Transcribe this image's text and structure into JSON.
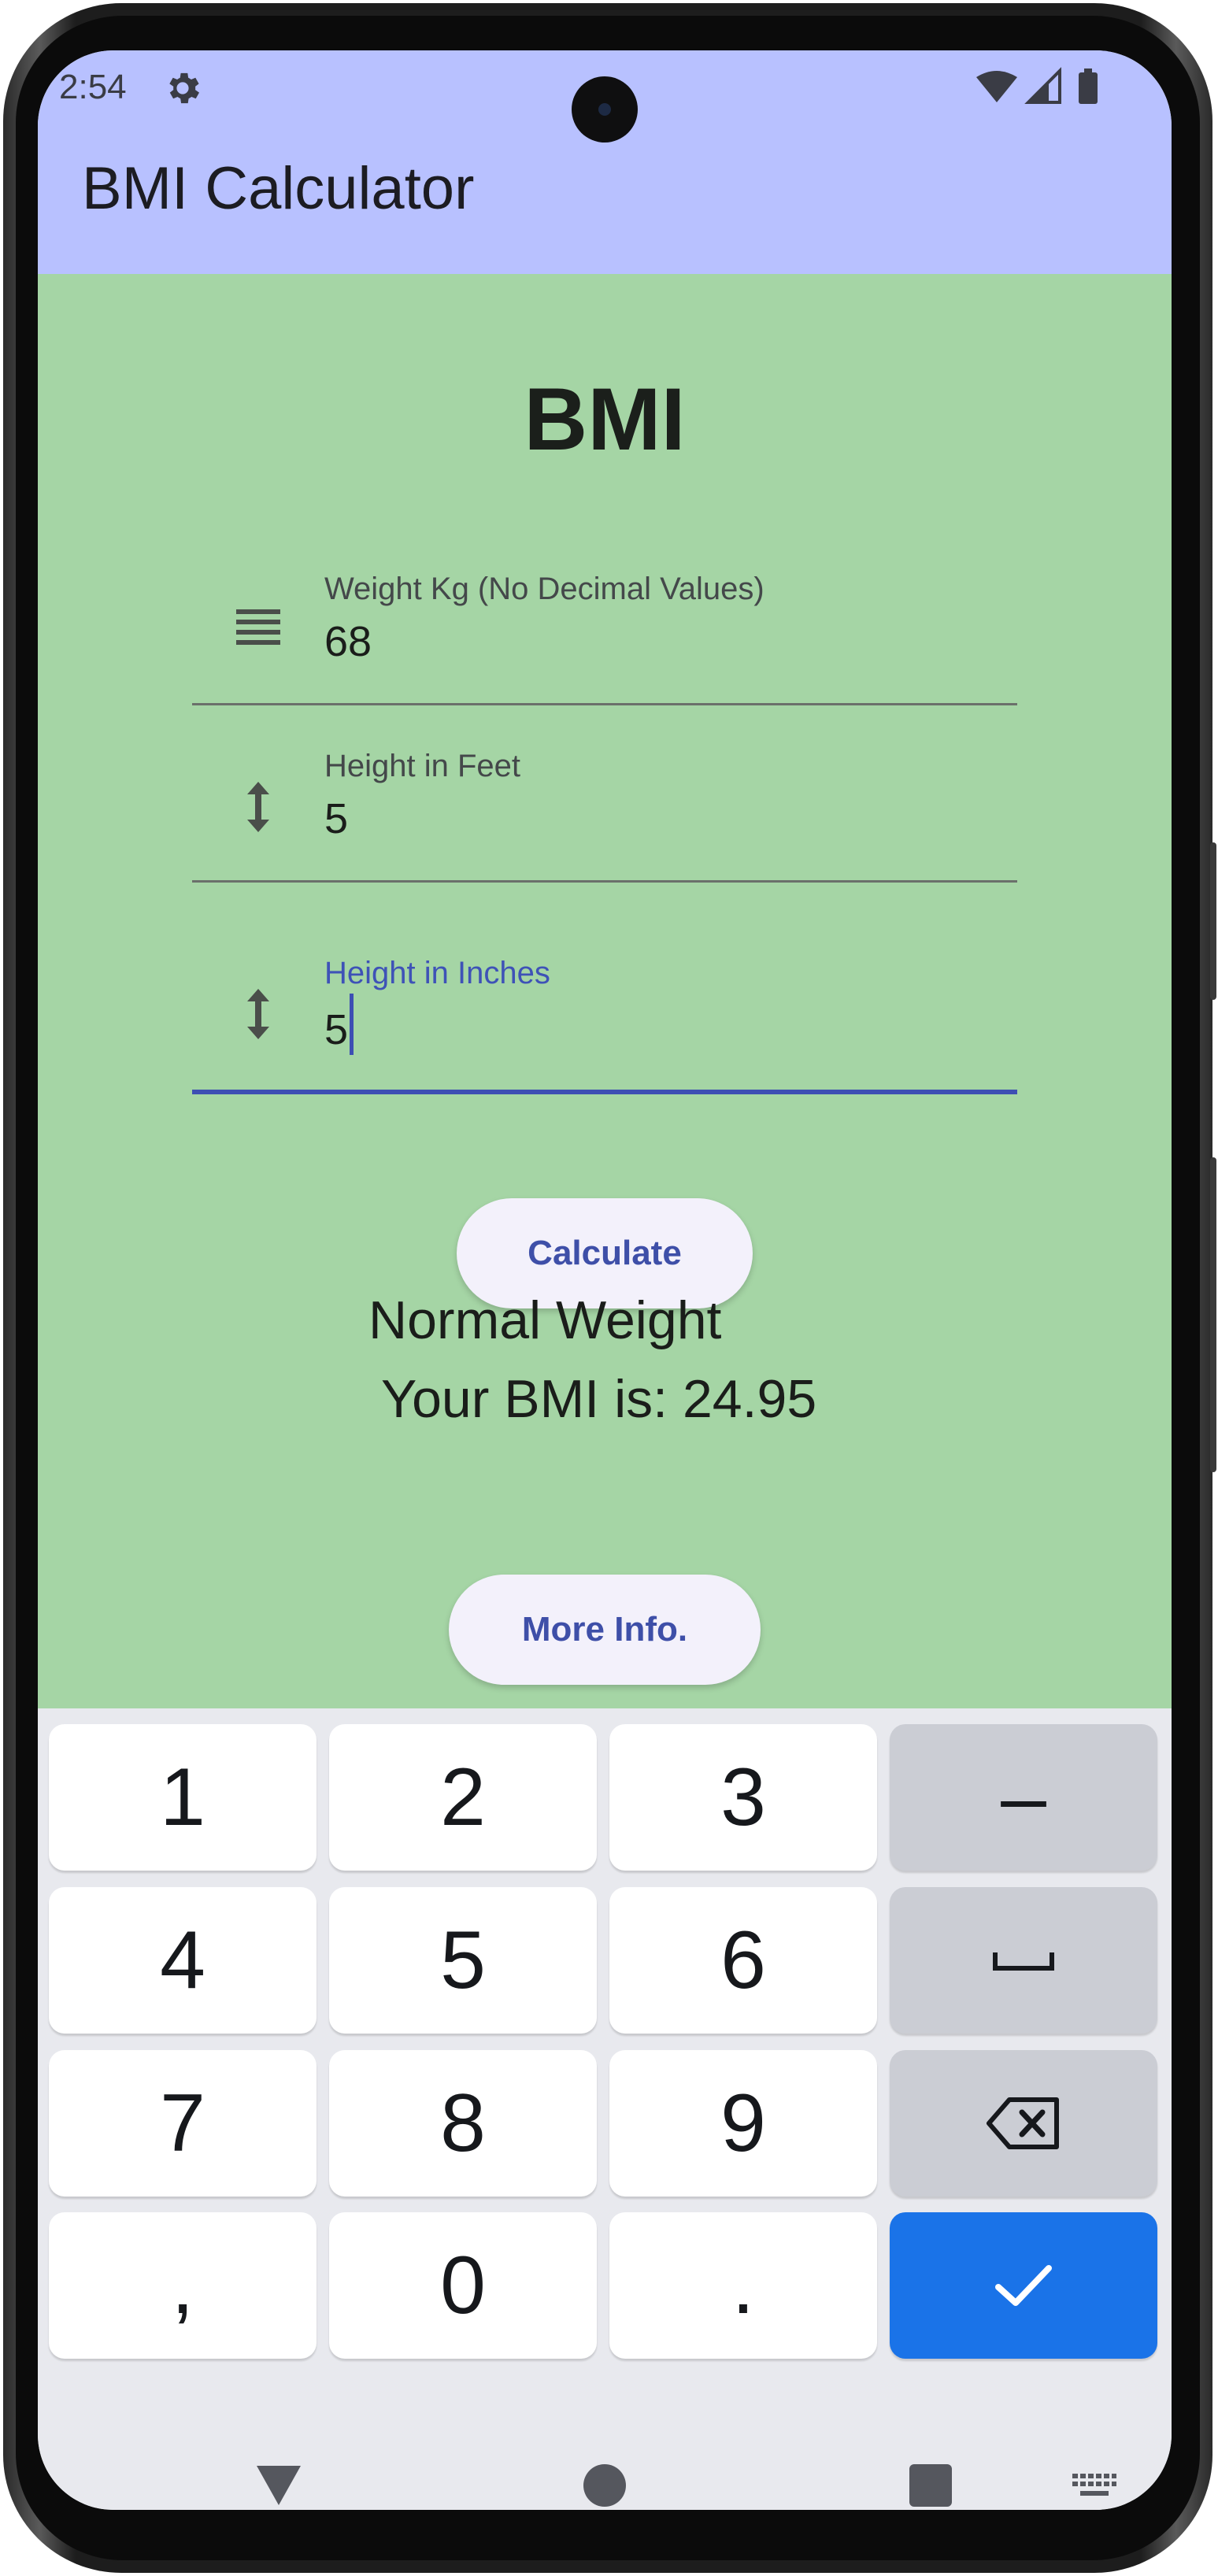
{
  "status_bar": {
    "time": "2:54",
    "icons": [
      "gear-icon",
      "wifi-icon",
      "signal-icon",
      "battery-icon"
    ]
  },
  "app_bar": {
    "title": "BMI Calculator",
    "background": "#b8c1ff"
  },
  "main": {
    "background": "#a5d5a5",
    "heading": "BMI",
    "fields": [
      {
        "label": "Weight Kg (No Decimal Values)",
        "value": "68",
        "icon": "weight-lines-icon"
      },
      {
        "label": "Height in Feet",
        "value": "5",
        "icon": "vertical-arrows-icon"
      },
      {
        "label": "Height in Inches",
        "value": "5",
        "icon": "vertical-arrows-icon",
        "focused": true
      }
    ],
    "calculate_label": "Calculate",
    "result_category": "Normal Weight",
    "result_bmi": "Your BMI is: 24.95",
    "more_info_label": "More Info.",
    "accent": "#3d4fb3"
  },
  "keyboard": {
    "rows": [
      [
        "1",
        "2",
        "3",
        "–"
      ],
      [
        "4",
        "5",
        "6",
        "space-icon"
      ],
      [
        "7",
        "8",
        "9",
        "backspace-icon"
      ],
      [
        ",",
        "0",
        ".",
        "check-icon"
      ]
    ],
    "confirm_color": "#1a73e8"
  },
  "nav_bar": {
    "items": [
      "back-icon",
      "home-icon",
      "recents-icon",
      "keyboard-switch-icon"
    ]
  }
}
